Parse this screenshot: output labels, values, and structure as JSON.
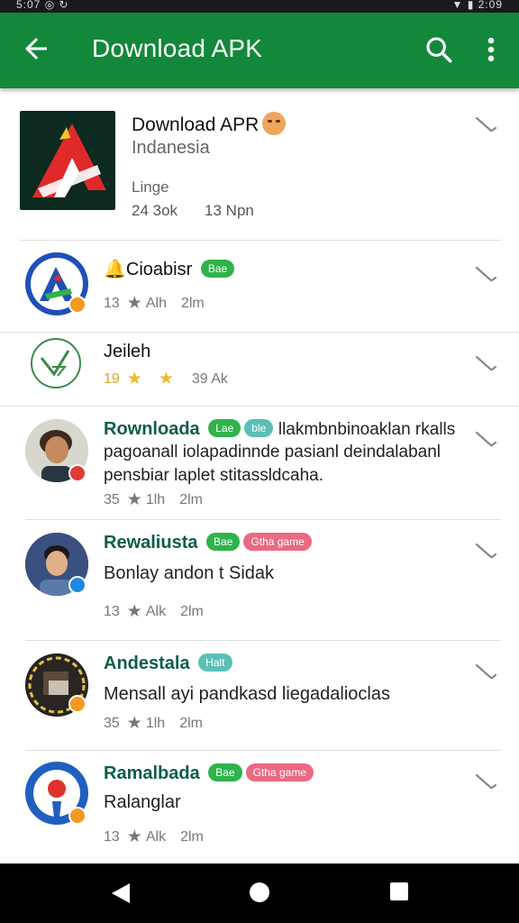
{
  "statusbar": {
    "left": "5:07 ◎ ↻",
    "right": "▼ ▮ 2:09"
  },
  "appbar": {
    "title": "Download APK"
  },
  "hero": {
    "name": "Download APR",
    "country": "Indanesia",
    "language": "Linge",
    "stat1": "24 3ok",
    "stat2": "13 Npn"
  },
  "items": [
    {
      "title": "Cioabisr",
      "chip1": "Bae",
      "m1": "13",
      "m2": "Alh",
      "m3": "2lm"
    },
    {
      "title": "Jeileh",
      "m1": "19",
      "m2": "39 Ak"
    },
    {
      "title": "Rownloada",
      "chip1": "Lae",
      "chip2": "ble",
      "title_tail": "llakmbnbinoaklan rkalls",
      "desc": "pagoanall iolapadinnde pasianl deindalabanl pensbiar laplet stitassldcaha.",
      "m1": "35",
      "m2": "1lh",
      "m3": "2lm"
    },
    {
      "title": "Rewaliusta",
      "chip1": "Bae",
      "chip2": "Gtha game",
      "desc": "Bonlay andon t Sidak",
      "m1": "13",
      "m2": "Alk",
      "m3": "2lm"
    },
    {
      "title": "Andestala",
      "chip1": "Halt",
      "desc": "Mensall ayi pandkasd liegadalioclas",
      "m1": "35",
      "m2": "1lh",
      "m3": "2lm"
    },
    {
      "title": "Ramalbada",
      "chip1": "Bae",
      "chip2": "Gtha game",
      "desc": "Ralanglar",
      "m1": "13",
      "m2": "Alk",
      "m3": "2lm"
    }
  ],
  "colors": {
    "appbar": "#13883b",
    "accent_teal": "#0f5c4c",
    "chip_green": "#2fb34a",
    "chip_pink": "#ea6a82",
    "chip_teal": "#5bbfb6"
  }
}
